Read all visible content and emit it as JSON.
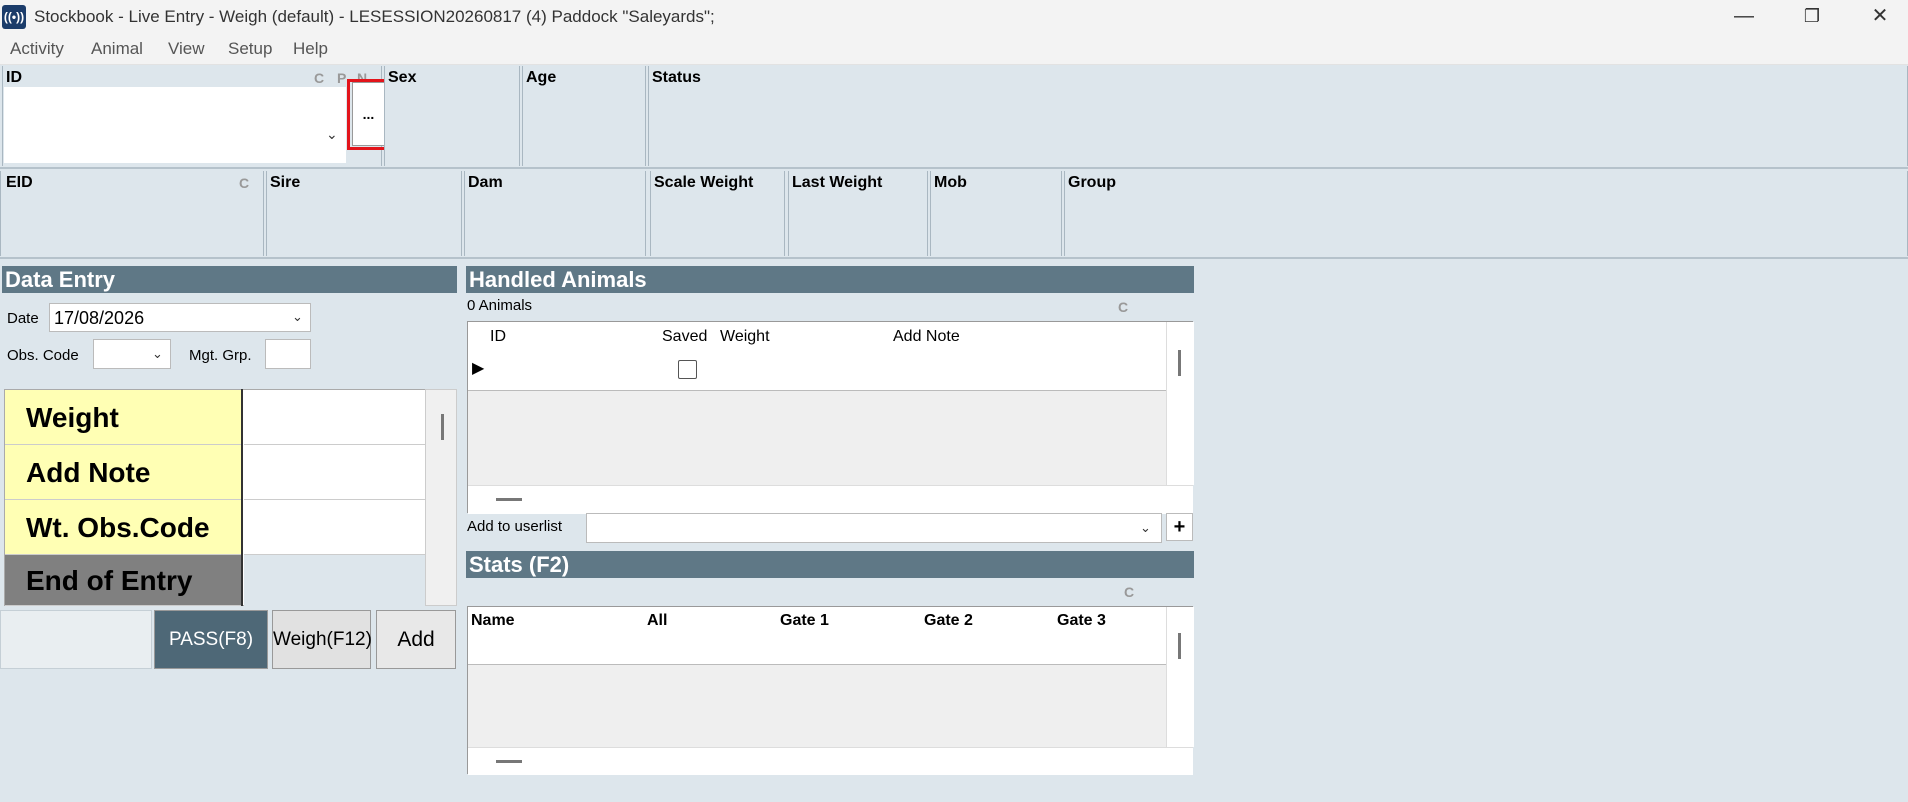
{
  "window": {
    "title": "Stockbook - Live Entry - Weigh (default) - LESESSION20260817 (4) Paddock \"Saleyards\";",
    "icon_glyph": "((•))",
    "minimize_glyph": "—",
    "restore_glyph": "❐",
    "close_glyph": "✕"
  },
  "menu": [
    "Activity",
    "Animal",
    "View",
    "Setup",
    "Help"
  ],
  "info_row1": {
    "id_label": "ID",
    "flag_c": "C",
    "flag_p": "P",
    "flag_n": "N",
    "ellipsis": "...",
    "sex_label": "Sex",
    "age_label": "Age",
    "status_label": "Status"
  },
  "info_row2": {
    "eid_label": "EID",
    "eid_flag": "C",
    "sire_label": "Sire",
    "dam_label": "Dam",
    "scale_weight_label": "Scale Weight",
    "last_weight_label": "Last Weight",
    "mob_label": "Mob",
    "group_label": "Group"
  },
  "data_entry": {
    "title": "Data Entry",
    "date_label": "Date",
    "date_value": "17/08/2026",
    "obs_code_label": "Obs. Code",
    "mgt_grp_label": "Mgt. Grp.",
    "rows": [
      "Weight",
      "Add Note",
      "Wt. Obs.Code",
      "End of Entry"
    ],
    "pass_button": "PASS(F8)",
    "weigh_button": "Weigh(F12)",
    "add_button": "Add"
  },
  "handled_animals": {
    "title": "Handled Animals",
    "count": "0 Animals",
    "flag": "C",
    "columns": [
      "ID",
      "Saved",
      "Weight",
      "Add Note"
    ],
    "add_to_userlist_label": "Add to userlist",
    "plus": "+"
  },
  "stats": {
    "title": "Stats (F2)",
    "flag": "C",
    "columns": [
      "Name",
      "All",
      "Gate 1",
      "Gate 2",
      "Gate 3"
    ]
  },
  "colors": {
    "background": "#dde6ec",
    "panel_header": "#5f7886",
    "entry_label_bg": "#ffffb4",
    "highlight": "#e3141b"
  }
}
